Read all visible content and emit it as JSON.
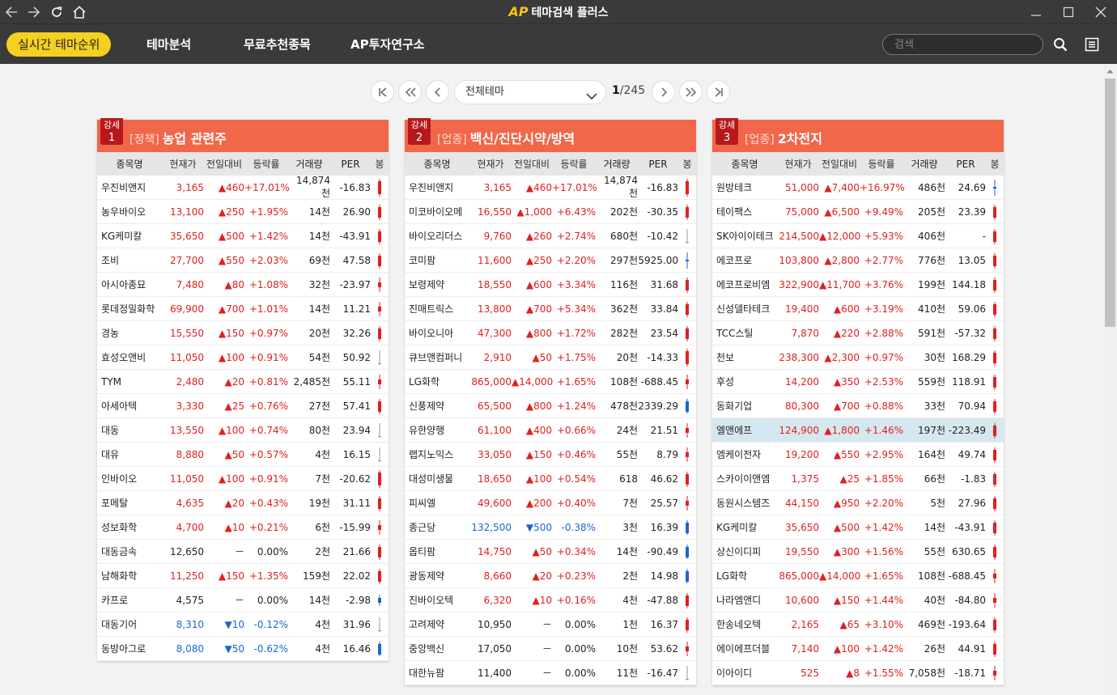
{
  "app": {
    "logo": "AP",
    "title": "테마검색 플러스"
  },
  "nav": {
    "items": [
      "실시간 테마순위",
      "테마분석",
      "무료추천종목",
      "AP투자연구소"
    ],
    "active_index": 0,
    "search_placeholder": "검색"
  },
  "pager": {
    "theme_selected": "전체테마",
    "current_page": "1",
    "total_pages": "/245"
  },
  "columns": [
    "종목명",
    "현재가",
    "전일대비",
    "등락률",
    "거래량",
    "PER",
    "봉"
  ],
  "colors": {
    "up": "#e02020",
    "down": "#1a66d1",
    "header": "#f0674a",
    "badge": "#b8181c",
    "highlight": "#d6e8ef"
  },
  "panels": [
    {
      "badge_label": "강세",
      "rank": "1",
      "category": "[정책]",
      "title": "농업 관련주",
      "rows": [
        {
          "name": "우진비앤지",
          "price": "3,165",
          "diff": "▲460",
          "rate": "+17.01%",
          "vol": "14,874천",
          "per": "-16.83",
          "dir": "up",
          "bong": "up-tall"
        },
        {
          "name": "농우바이오",
          "price": "13,100",
          "diff": "▲250",
          "rate": "+1.95%",
          "vol": "14천",
          "per": "26.90",
          "dir": "up",
          "bong": "up"
        },
        {
          "name": "KG케미칼",
          "price": "35,650",
          "diff": "▲500",
          "rate": "+1.42%",
          "vol": "14천",
          "per": "-43.91",
          "dir": "up",
          "bong": "up"
        },
        {
          "name": "조비",
          "price": "27,700",
          "diff": "▲550",
          "rate": "+2.03%",
          "vol": "69천",
          "per": "47.58",
          "dir": "up",
          "bong": "up"
        },
        {
          "name": "아시아종묘",
          "price": "7,480",
          "diff": "▲80",
          "rate": "+1.08%",
          "vol": "32천",
          "per": "-23.97",
          "dir": "up",
          "bong": "up-small"
        },
        {
          "name": "롯데정밀화학",
          "price": "69,900",
          "diff": "▲700",
          "rate": "+1.01%",
          "vol": "14천",
          "per": "11.21",
          "dir": "up",
          "bong": "up-small"
        },
        {
          "name": "경농",
          "price": "15,550",
          "diff": "▲150",
          "rate": "+0.97%",
          "vol": "20천",
          "per": "32.26",
          "dir": "up",
          "bong": "up"
        },
        {
          "name": "효성오앤비",
          "price": "11,050",
          "diff": "▲100",
          "rate": "+0.91%",
          "vol": "54천",
          "per": "50.92",
          "dir": "up",
          "bong": "line"
        },
        {
          "name": "TYM",
          "price": "2,480",
          "diff": "▲20",
          "rate": "+0.81%",
          "vol": "2,485천",
          "per": "55.11",
          "dir": "up",
          "bong": "up-small"
        },
        {
          "name": "아세아텍",
          "price": "3,330",
          "diff": "▲25",
          "rate": "+0.76%",
          "vol": "27천",
          "per": "57.41",
          "dir": "up",
          "bong": "up"
        },
        {
          "name": "대동",
          "price": "13,550",
          "diff": "▲100",
          "rate": "+0.74%",
          "vol": "80천",
          "per": "23.94",
          "dir": "up",
          "bong": "line"
        },
        {
          "name": "대유",
          "price": "8,880",
          "diff": "▲50",
          "rate": "+0.57%",
          "vol": "4천",
          "per": "16.15",
          "dir": "up",
          "bong": "line"
        },
        {
          "name": "인바이오",
          "price": "11,050",
          "diff": "▲100",
          "rate": "+0.91%",
          "vol": "7천",
          "per": "-20.62",
          "dir": "up",
          "bong": "up-tall"
        },
        {
          "name": "포메탈",
          "price": "4,635",
          "diff": "▲20",
          "rate": "+0.43%",
          "vol": "19천",
          "per": "31.11",
          "dir": "up",
          "bong": "up"
        },
        {
          "name": "성보화학",
          "price": "4,700",
          "diff": "▲10",
          "rate": "+0.21%",
          "vol": "6천",
          "per": "-15.99",
          "dir": "up",
          "bong": "up-small"
        },
        {
          "name": "대동금속",
          "price": "12,650",
          "diff": "－",
          "rate": "0.00%",
          "vol": "2천",
          "per": "21.66",
          "dir": "flat",
          "bong": "up"
        },
        {
          "name": "남해화학",
          "price": "11,250",
          "diff": "▲150",
          "rate": "+1.35%",
          "vol": "159천",
          "per": "22.02",
          "dir": "up",
          "bong": "up"
        },
        {
          "name": "카프로",
          "price": "4,575",
          "diff": "－",
          "rate": "0.00%",
          "vol": "14천",
          "per": "-2.98",
          "dir": "flat",
          "bong": "down-small"
        },
        {
          "name": "대동기어",
          "price": "8,310",
          "diff": "▼10",
          "rate": "-0.12%",
          "vol": "4천",
          "per": "31.96",
          "dir": "down",
          "bong": "line"
        },
        {
          "name": "동방아그로",
          "price": "8,080",
          "diff": "▼50",
          "rate": "-0.62%",
          "vol": "4천",
          "per": "16.46",
          "dir": "down",
          "bong": "down"
        }
      ]
    },
    {
      "badge_label": "강세",
      "rank": "2",
      "category": "[업종]",
      "title": "백신/진단시약/방역",
      "rows": [
        {
          "name": "우진비앤지",
          "price": "3,165",
          "diff": "▲460",
          "rate": "+17.01%",
          "vol": "14,874천",
          "per": "-16.83",
          "dir": "up",
          "bong": "up-tall"
        },
        {
          "name": "미코바이오메",
          "price": "16,550",
          "diff": "▲1,000",
          "rate": "+6.43%",
          "vol": "202천",
          "per": "-30.35",
          "dir": "up",
          "bong": "up"
        },
        {
          "name": "바이오리더스",
          "price": "9,760",
          "diff": "▲260",
          "rate": "+2.74%",
          "vol": "680천",
          "per": "-10.42",
          "dir": "up",
          "bong": "line"
        },
        {
          "name": "코미팜",
          "price": "11,600",
          "diff": "▲250",
          "rate": "+2.20%",
          "vol": "297천",
          "per": "5925.00",
          "dir": "up",
          "bong": "down-line"
        },
        {
          "name": "보령제약",
          "price": "18,550",
          "diff": "▲600",
          "rate": "+3.34%",
          "vol": "116천",
          "per": "31.68",
          "dir": "up",
          "bong": "up"
        },
        {
          "name": "진매트릭스",
          "price": "13,800",
          "diff": "▲700",
          "rate": "+5.34%",
          "vol": "362천",
          "per": "33.84",
          "dir": "up",
          "bong": "up"
        },
        {
          "name": "바이오니아",
          "price": "47,300",
          "diff": "▲800",
          "rate": "+1.72%",
          "vol": "282천",
          "per": "23.54",
          "dir": "up",
          "bong": "up"
        },
        {
          "name": "큐브앤컴퍼니",
          "price": "2,910",
          "diff": "▲50",
          "rate": "+1.75%",
          "vol": "20천",
          "per": "-14.33",
          "dir": "up",
          "bong": "up-tall"
        },
        {
          "name": "LG화학",
          "price": "865,000",
          "diff": "▲14,000",
          "rate": "+1.65%",
          "vol": "108천",
          "per": "-688.45",
          "dir": "up",
          "bong": "up-small"
        },
        {
          "name": "신풍제약",
          "price": "65,500",
          "diff": "▲800",
          "rate": "+1.24%",
          "vol": "478천",
          "per": "2339.29",
          "dir": "up",
          "bong": "down"
        },
        {
          "name": "유한양행",
          "price": "61,100",
          "diff": "▲400",
          "rate": "+0.66%",
          "vol": "24천",
          "per": "21.51",
          "dir": "up",
          "bong": "up-small"
        },
        {
          "name": "랩지노믹스",
          "price": "33,050",
          "diff": "▲150",
          "rate": "+0.46%",
          "vol": "55천",
          "per": "8.79",
          "dir": "up",
          "bong": "up-small"
        },
        {
          "name": "대성미생물",
          "price": "18,650",
          "diff": "▲100",
          "rate": "+0.54%",
          "vol": "618",
          "per": "46.62",
          "dir": "up",
          "bong": "up"
        },
        {
          "name": "피씨엘",
          "price": "49,600",
          "diff": "▲200",
          "rate": "+0.40%",
          "vol": "7천",
          "per": "25.57",
          "dir": "up",
          "bong": "up-small"
        },
        {
          "name": "종근당",
          "price": "132,500",
          "diff": "▼500",
          "rate": "-0.38%",
          "vol": "3천",
          "per": "16.39",
          "dir": "down",
          "bong": "down"
        },
        {
          "name": "옵티팜",
          "price": "14,750",
          "diff": "▲50",
          "rate": "+0.34%",
          "vol": "14천",
          "per": "-90.49",
          "dir": "up",
          "bong": "down"
        },
        {
          "name": "광동제약",
          "price": "8,660",
          "diff": "▲20",
          "rate": "+0.23%",
          "vol": "2천",
          "per": "14.98",
          "dir": "up",
          "bong": "down"
        },
        {
          "name": "진바이오텍",
          "price": "6,320",
          "diff": "▲10",
          "rate": "+0.16%",
          "vol": "4천",
          "per": "-47.88",
          "dir": "up",
          "bong": "up"
        },
        {
          "name": "고려제약",
          "price": "10,950",
          "diff": "－",
          "rate": "0.00%",
          "vol": "1천",
          "per": "16.37",
          "dir": "flat",
          "bong": "up"
        },
        {
          "name": "중앙백신",
          "price": "17,050",
          "diff": "－",
          "rate": "0.00%",
          "vol": "10천",
          "per": "53.62",
          "dir": "flat",
          "bong": "up-small"
        },
        {
          "name": "대한뉴팜",
          "price": "11,400",
          "diff": "－",
          "rate": "0.00%",
          "vol": "11천",
          "per": "-16.47",
          "dir": "flat",
          "bong": "line"
        }
      ]
    },
    {
      "badge_label": "강세",
      "rank": "3",
      "category": "[업종]",
      "title": "2차전지",
      "rows": [
        {
          "name": "원방테크",
          "price": "51,000",
          "diff": "▲7,400",
          "rate": "+16.97%",
          "vol": "486천",
          "per": "24.69",
          "dir": "up",
          "bong": "down-line"
        },
        {
          "name": "테이팩스",
          "price": "75,000",
          "diff": "▲6,500",
          "rate": "+9.49%",
          "vol": "205천",
          "per": "23.39",
          "dir": "up",
          "bong": "up"
        },
        {
          "name": "SK아이이테크",
          "price": "214,500",
          "diff": "▲12,000",
          "rate": "+5.93%",
          "vol": "406천",
          "per": "-",
          "dir": "up",
          "bong": "up"
        },
        {
          "name": "에코프로",
          "price": "103,800",
          "diff": "▲2,800",
          "rate": "+2.77%",
          "vol": "776천",
          "per": "13.05",
          "dir": "up",
          "bong": "up"
        },
        {
          "name": "에코프로비엠",
          "price": "322,900",
          "diff": "▲11,700",
          "rate": "+3.76%",
          "vol": "199천",
          "per": "144.18",
          "dir": "up",
          "bong": "up"
        },
        {
          "name": "신성델타테크",
          "price": "19,400",
          "diff": "▲600",
          "rate": "+3.19%",
          "vol": "410천",
          "per": "59.06",
          "dir": "up",
          "bong": "up"
        },
        {
          "name": "TCC스틸",
          "price": "7,870",
          "diff": "▲220",
          "rate": "+2.88%",
          "vol": "591천",
          "per": "-57.32",
          "dir": "up",
          "bong": "up"
        },
        {
          "name": "천보",
          "price": "238,300",
          "diff": "▲2,300",
          "rate": "+0.97%",
          "vol": "30천",
          "per": "168.29",
          "dir": "up",
          "bong": "up"
        },
        {
          "name": "후성",
          "price": "14,200",
          "diff": "▲350",
          "rate": "+2.53%",
          "vol": "559천",
          "per": "118.91",
          "dir": "up",
          "bong": "up"
        },
        {
          "name": "동화기업",
          "price": "80,300",
          "diff": "▲700",
          "rate": "+0.88%",
          "vol": "33천",
          "per": "70.94",
          "dir": "up",
          "bong": "up"
        },
        {
          "name": "엘앤에프",
          "price": "124,900",
          "diff": "▲1,800",
          "rate": "+1.46%",
          "vol": "197천",
          "per": "-223.49",
          "dir": "up",
          "bong": "up",
          "highlight": true
        },
        {
          "name": "엠케이전자",
          "price": "19,200",
          "diff": "▲550",
          "rate": "+2.95%",
          "vol": "164천",
          "per": "49.74",
          "dir": "up",
          "bong": "up"
        },
        {
          "name": "스카이이앤엠",
          "price": "1,375",
          "diff": "▲25",
          "rate": "+1.85%",
          "vol": "66천",
          "per": "-1.83",
          "dir": "up",
          "bong": "up"
        },
        {
          "name": "동원시스템즈",
          "price": "44,150",
          "diff": "▲950",
          "rate": "+2.20%",
          "vol": "5천",
          "per": "27.96",
          "dir": "up",
          "bong": "up"
        },
        {
          "name": "KG케미칼",
          "price": "35,650",
          "diff": "▲500",
          "rate": "+1.42%",
          "vol": "14천",
          "per": "-43.91",
          "dir": "up",
          "bong": "up"
        },
        {
          "name": "상신이디피",
          "price": "19,550",
          "diff": "▲300",
          "rate": "+1.56%",
          "vol": "55천",
          "per": "630.65",
          "dir": "up",
          "bong": "up"
        },
        {
          "name": "LG화학",
          "price": "865,000",
          "diff": "▲14,000",
          "rate": "+1.65%",
          "vol": "108천",
          "per": "-688.45",
          "dir": "up",
          "bong": "up-small"
        },
        {
          "name": "나라엠앤디",
          "price": "10,600",
          "diff": "▲150",
          "rate": "+1.44%",
          "vol": "40천",
          "per": "-84.80",
          "dir": "up",
          "bong": "up-small"
        },
        {
          "name": "한송네오텍",
          "price": "2,165",
          "diff": "▲65",
          "rate": "+3.10%",
          "vol": "469천",
          "per": "-193.64",
          "dir": "up",
          "bong": "up"
        },
        {
          "name": "에이에프더블",
          "price": "7,140",
          "diff": "▲100",
          "rate": "+1.42%",
          "vol": "26천",
          "per": "44.91",
          "dir": "up",
          "bong": "up"
        },
        {
          "name": "이아이디",
          "price": "525",
          "diff": "▲8",
          "rate": "+1.55%",
          "vol": "7,058천",
          "per": "-18.71",
          "dir": "up",
          "bong": "up-small"
        }
      ]
    }
  ]
}
